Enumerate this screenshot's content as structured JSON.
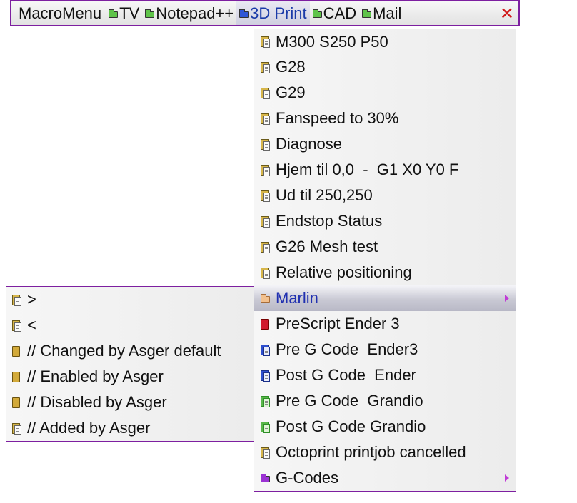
{
  "menubar": {
    "title": "MacroMenu",
    "items": [
      {
        "label": "TV"
      },
      {
        "label": "Notepad++"
      },
      {
        "label": "3D Print"
      },
      {
        "label": "CAD"
      },
      {
        "label": "Mail"
      }
    ],
    "close_glyph": "✕"
  },
  "menu_3d_print": {
    "items": [
      {
        "label": "M300 S250 P50",
        "icon": "macro-doc-icon"
      },
      {
        "label": "G28",
        "icon": "macro-doc-icon"
      },
      {
        "label": "G29",
        "icon": "macro-doc-icon"
      },
      {
        "label": "Fanspeed to 30%",
        "icon": "macro-doc-icon"
      },
      {
        "label": "Diagnose",
        "icon": "macro-doc-icon"
      },
      {
        "label": "Hjem til 0,0  -  G1 X0 Y0 F",
        "icon": "macro-doc-icon"
      },
      {
        "label": "Ud til 250,250",
        "icon": "macro-doc-icon"
      },
      {
        "label": "Endstop Status",
        "icon": "macro-doc-icon"
      },
      {
        "label": "G26 Mesh test",
        "icon": "macro-doc-icon"
      },
      {
        "label": "Relative positioning",
        "icon": "macro-doc-icon"
      },
      {
        "label": "Marlin",
        "icon": "folder-icon",
        "submenu": true,
        "highlighted": true
      },
      {
        "label": "PreScript Ender 3",
        "icon": "red-script-icon"
      },
      {
        "label": "Pre G Code  Ender3",
        "icon": "blue-doc-icon"
      },
      {
        "label": "Post G Code  Ender",
        "icon": "blue-doc-icon"
      },
      {
        "label": "Pre G Code  Grandio",
        "icon": "green-doc-icon"
      },
      {
        "label": "Post G Code Grandio",
        "icon": "green-doc-icon"
      },
      {
        "label": "Octoprint printjob cancelled",
        "icon": "macro-doc-icon"
      },
      {
        "label": "G-Codes",
        "icon": "folder-icon",
        "submenu": true
      }
    ]
  },
  "menu_marlin": {
    "items": [
      {
        "label": ">",
        "icon": "macro-doc-icon"
      },
      {
        "label": "<",
        "icon": "macro-doc-icon"
      },
      {
        "label": "// Changed by Asger default",
        "icon": "gold-script-icon"
      },
      {
        "label": "// Enabled by Asger",
        "icon": "gold-script-icon"
      },
      {
        "label": "// Disabled by Asger",
        "icon": "gold-script-icon"
      },
      {
        "label": "// Added by Asger",
        "icon": "macro-doc-icon"
      }
    ]
  },
  "colors": {
    "border_accent": "#7d1fa0",
    "active_text": "#1a3aa8",
    "close_red": "#d01818",
    "submenu_arrow": "#c03ad6"
  }
}
